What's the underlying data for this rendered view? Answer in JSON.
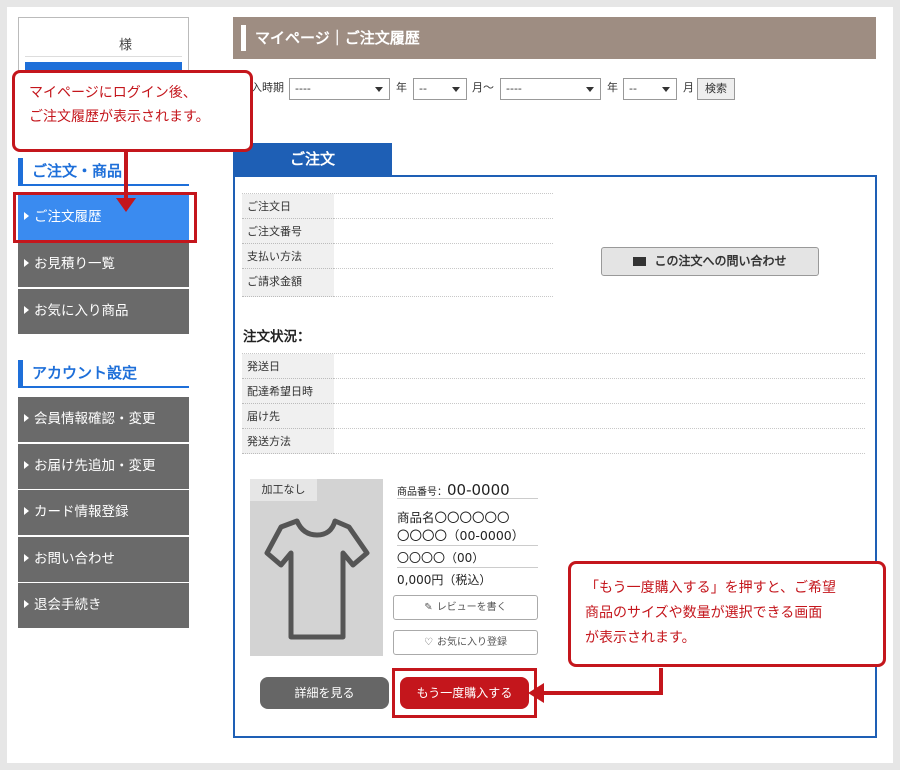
{
  "sidebar": {
    "user_suffix": "様",
    "section_orders": "ご注文・商品",
    "orders_items": [
      "ご注文履歴",
      "お見積り一覧",
      "お気に入り商品"
    ],
    "section_account": "アカウント設定",
    "account_items": [
      "会員情報確認・変更",
      "お届け先追加・変更",
      "カード情報登録",
      "お問い合わせ",
      "退会手続き"
    ]
  },
  "header": {
    "title": "マイページ｜ご注文履歴"
  },
  "filter": {
    "label": "購入時期",
    "from_year": "----",
    "year_label": "年",
    "from_month": "--",
    "month_from_label": "月〜",
    "to_year": "----",
    "year_label_2": "年",
    "to_month": "--",
    "month_label": "月",
    "search_label": "検索"
  },
  "order": {
    "tab_label": "ご注文",
    "fields": [
      "ご注文日",
      "ご注文番号",
      "支払い方法",
      "ご請求金額"
    ],
    "inquiry_label": "この注文への問い合わせ",
    "status_title": "注文状況：",
    "status_fields": [
      "発送日",
      "配達希望日時",
      "届け先",
      "発送方法"
    ]
  },
  "product": {
    "tag": "加工なし",
    "number_label": "商品番号：",
    "number_value": "00-0000",
    "name_line1": "商品名〇〇〇〇〇〇",
    "name_line2": "〇〇〇〇（00-0000）",
    "variant": "〇〇〇〇（00）",
    "price": "0,000円（税込）",
    "review_label": "レビューを書く",
    "favorite_label": "お気に入り登録",
    "detail_label": "詳細を見る",
    "rebuy_label": "もう一度購入する"
  },
  "annotations": {
    "top_line1": "マイページにログイン後、",
    "top_line2": "ご注文履歴が表示されます。",
    "bottom_line1": "「もう一度購入する」を押すと、ご希望",
    "bottom_line2": "商品のサイズや数量が選択できる画面",
    "bottom_line3": "が表示されます。"
  },
  "colors": {
    "accent_blue": "#1e6fd9",
    "nav_gray": "#6a6a6a",
    "header_brown": "#9e8d82",
    "annotation_red": "#c4161c"
  }
}
